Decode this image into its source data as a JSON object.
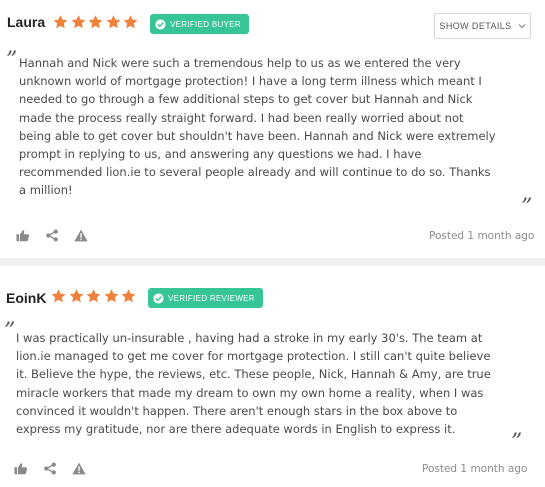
{
  "colors": {
    "star": "#f0813c",
    "badge": "#37c598",
    "divider": "#f1f1f1",
    "icon": "#8a8a8a"
  },
  "show_details": {
    "label": "SHOW DETAILS",
    "icon": "chevron-down-icon"
  },
  "reviews": [
    {
      "author": "Laura",
      "rating": 5,
      "badge": "VERIFIED BUYER",
      "open_quote": "”",
      "close_quote": "”",
      "text": "Hannah and Nick were such a tremendous help to us as we entered the very\nunknown world of mortgage protection! I have a long term illness which meant I\nneeded to go through a few additional steps to get cover but Hannah and Nick\nmade the process really straight forward. I had been really worried about not\nbeing able to get cover but shouldn't have been. Hannah and Nick were extremely\nprompt in replying to us, and answering any questions we had. I have\nrecommended lion.ie to several people already and will continue to do so. Thanks\na million!",
      "posted": "Posted 1 month ago",
      "actions": [
        "thumbs-up-icon",
        "share-icon",
        "report-icon"
      ]
    },
    {
      "author": "EoinK",
      "rating": 5,
      "badge": "VERIFIED REVIEWER",
      "open_quote": "”",
      "close_quote": "”",
      "text": "I was practically un-insurable , having had a stroke in my early 30's. The team at\nlion.ie managed to get me cover for mortgage protection. I still can't quite believe\nit. Believe the hype, the reviews, etc. These people, Nick, Hannah & Amy, are true\nmiracle workers that made my dream to own my own home a reality, when I was\nconvinced it wouldn't happen. There aren't enough stars in the box above to\nexpress my gratitude, nor are there adequate words in English to express it.",
      "posted": "Posted 1 month ago",
      "actions": [
        "thumbs-up-icon",
        "share-icon",
        "report-icon"
      ]
    }
  ]
}
